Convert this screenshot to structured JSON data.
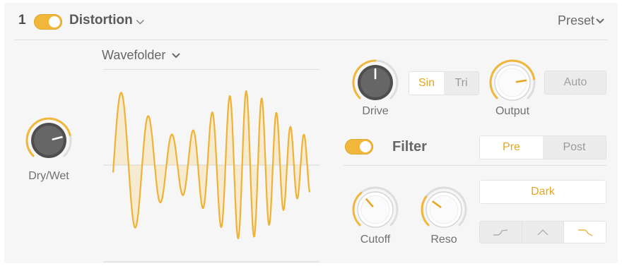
{
  "header": {
    "slot_number": "1",
    "effect_name": "Distortion",
    "preset_label": "Preset"
  },
  "mode": {
    "selected": "Wavefolder"
  },
  "knobs": {
    "dry_wet": {
      "label": "Dry/Wet",
      "value": 0.78
    },
    "drive": {
      "label": "Drive",
      "value": 0.5
    },
    "output": {
      "label": "Output",
      "value": 0.8
    },
    "cutoff": {
      "label": "Cutoff",
      "value": 0.35
    },
    "reso": {
      "label": "Reso",
      "value": 0.3
    }
  },
  "waveform_selector": {
    "options": [
      "Sin",
      "Tri"
    ],
    "selected": "Sin"
  },
  "auto_button": {
    "label": "Auto"
  },
  "filter": {
    "label": "Filter",
    "enabled": true,
    "position_options": [
      "Pre",
      "Post"
    ],
    "position_selected": "Pre",
    "character": "Dark",
    "filter_types": [
      "lowpass-icon",
      "bandpass-icon",
      "highpass-icon"
    ],
    "filter_type_selected": "highpass-icon"
  },
  "colors": {
    "accent": "#f0b73a",
    "panel": "#f6f6f6",
    "knob_body": "#5a5a5a"
  }
}
